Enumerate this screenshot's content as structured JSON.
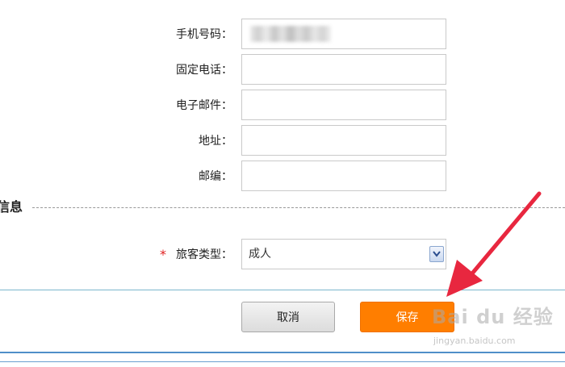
{
  "form": {
    "fields": [
      {
        "label": "手机号码：",
        "value": ""
      },
      {
        "label": "固定电话：",
        "value": ""
      },
      {
        "label": "电子邮件：",
        "value": ""
      },
      {
        "label": "地址：",
        "value": ""
      },
      {
        "label": "邮编：",
        "value": ""
      }
    ]
  },
  "section": {
    "title": "信息"
  },
  "passenger_type": {
    "required_mark": "*",
    "label": "旅客类型：",
    "selected": "成人"
  },
  "buttons": {
    "cancel": "取消",
    "save": "保存"
  },
  "watermark": {
    "brand": "Bai du 经验",
    "url": "jingyan.baidu.com"
  },
  "colors": {
    "save_button": "#ff7e00",
    "annotation_arrow": "#e8273f",
    "required_mark": "#e02020"
  }
}
